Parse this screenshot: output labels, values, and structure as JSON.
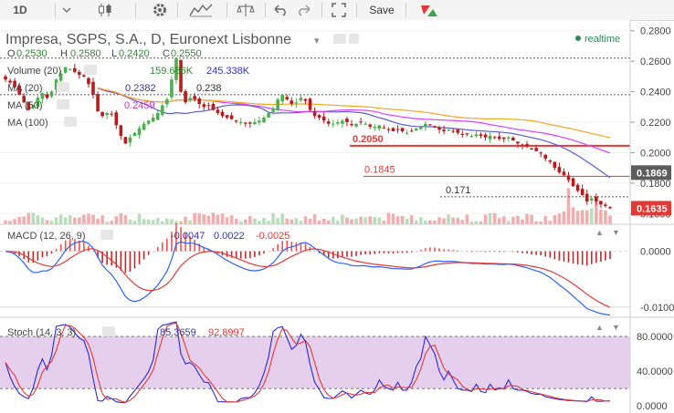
{
  "toolbar": {
    "interval": "1D",
    "save_label": "Save",
    "icons": [
      "candles-icon",
      "settings-icon",
      "indicators-icon",
      "compare-icon",
      "undo-icon",
      "redo-icon",
      "fullscreen-icon",
      "logo-icon"
    ]
  },
  "header": {
    "title": "Impresa, SGPS, S.A., D, Euronext Lisbonne",
    "realtime": "realtime",
    "ohlc": [
      {
        "k": "O",
        "v": "0.2530"
      },
      {
        "k": "H",
        "v": "0.2580"
      },
      {
        "k": "L",
        "v": "0.2420"
      },
      {
        "k": "C",
        "v": "0.2550"
      }
    ]
  },
  "legends": {
    "volume": {
      "name": "Volume (20)",
      "v1": "159.686K",
      "v2": "245.338K"
    },
    "ma20": {
      "name": "MA (20)",
      "value": "0.2382"
    },
    "ma50": {
      "name": "MA (50)",
      "value": "0.2459"
    },
    "ma100": {
      "name": "MA (100)",
      "value": ""
    },
    "macd": {
      "name": "MACD (12, 26, 9)",
      "v1": "-0.0047",
      "v2": "0.0022",
      "v3": "-0.0025"
    },
    "stoch": {
      "name": "Stoch (14, 3, 3)",
      "v1": "85.3659",
      "v2": "92.8997"
    }
  },
  "colors": {
    "up": "#4caf50",
    "down": "#b71c1c",
    "ma20": "#5b5bd6",
    "ma50": "#e040fb",
    "ma100": "#f5a623",
    "price_tag": "#e53935",
    "level_tag": "#5c5c5c",
    "macd": "#2962ff",
    "signal": "#e53935",
    "stoch_k": "#2a2ad8",
    "stoch_d": "#e53935",
    "stoch_band": "#e2c6ea"
  },
  "chart_data": [
    {
      "type": "candlestick",
      "title": "Impresa, SGPS, S.A., D, Euronext Lisbonne",
      "ylim": [
        0.153,
        0.287
      ],
      "y_ticks": [
        "0.2800",
        "0.2600",
        "0.2400",
        "0.2200",
        "0.2000",
        "0.1800",
        "0.1600"
      ],
      "last_price": "0.1635",
      "price_tags": [
        {
          "label": "0.1869",
          "value": 0.1869,
          "kind": "level"
        },
        {
          "label": "0.1635",
          "value": 0.1635,
          "kind": "price"
        }
      ],
      "hlines": [
        {
          "label": "",
          "value": 0.262,
          "style": "dotted"
        },
        {
          "label": "0.238",
          "value": 0.238,
          "style": "dotted"
        },
        {
          "label": "0.2050",
          "value": 0.2045,
          "style": "red"
        },
        {
          "label": "0.1845",
          "value": 0.1845,
          "style": "red-thin"
        },
        {
          "label": "0.171",
          "value": 0.171,
          "style": "dotted"
        }
      ],
      "close": [
        0.248,
        0.246,
        0.243,
        0.238,
        0.233,
        0.228,
        0.231,
        0.236,
        0.239,
        0.236,
        0.24,
        0.248,
        0.252,
        0.256,
        0.255,
        0.253,
        0.251,
        0.25,
        0.245,
        0.238,
        0.227,
        0.224,
        0.226,
        0.225,
        0.218,
        0.211,
        0.206,
        0.21,
        0.213,
        0.216,
        0.219,
        0.221,
        0.223,
        0.226,
        0.231,
        0.235,
        0.248,
        0.262,
        0.24,
        0.233,
        0.236,
        0.235,
        0.232,
        0.23,
        0.231,
        0.228,
        0.226,
        0.224,
        0.223,
        0.222,
        0.221,
        0.22,
        0.219,
        0.219,
        0.22,
        0.221,
        0.223,
        0.226,
        0.229,
        0.235,
        0.238,
        0.235,
        0.232,
        0.233,
        0.236,
        0.234,
        0.228,
        0.224,
        0.223,
        0.221,
        0.219,
        0.219,
        0.22,
        0.221,
        0.22,
        0.218,
        0.219,
        0.22,
        0.219,
        0.217,
        0.217,
        0.218,
        0.216,
        0.215,
        0.214,
        0.215,
        0.214,
        0.213,
        0.214,
        0.216,
        0.217,
        0.219,
        0.218,
        0.217,
        0.215,
        0.214,
        0.215,
        0.214,
        0.213,
        0.212,
        0.212,
        0.211,
        0.212,
        0.211,
        0.21,
        0.211,
        0.21,
        0.209,
        0.209,
        0.21,
        0.208,
        0.206,
        0.205,
        0.204,
        0.202,
        0.201,
        0.2,
        0.196,
        0.194,
        0.19,
        0.187,
        0.185,
        0.182,
        0.178,
        0.175,
        0.172,
        0.168,
        0.17,
        0.168,
        0.166,
        0.165,
        0.1635
      ],
      "volume_avg": [
        245,
        240,
        236,
        233,
        230
      ],
      "ma20": [
        0.2382
      ],
      "ma50": [
        0.2459
      ]
    },
    {
      "type": "line",
      "title": "MACD (12, 26, 9)",
      "ylim": [
        -0.0115,
        0.0045
      ],
      "y_ticks": [
        "0.0000",
        "-0.0100"
      ],
      "series": [
        {
          "name": "MACD",
          "last": "-0.0047"
        },
        {
          "name": "Signal",
          "last": "0.0022"
        },
        {
          "name": "Histogram",
          "last": "-0.0025"
        }
      ]
    },
    {
      "type": "line",
      "title": "Stoch (14, 3, 3)",
      "ylim": [
        -5,
        100
      ],
      "y_ticks": [
        "80.0000",
        "40.0000",
        "0.0000"
      ],
      "band": [
        20,
        80
      ],
      "series": [
        {
          "name": "%K",
          "last": "85.3659"
        },
        {
          "name": "%D",
          "last": "92.8997"
        }
      ]
    }
  ]
}
